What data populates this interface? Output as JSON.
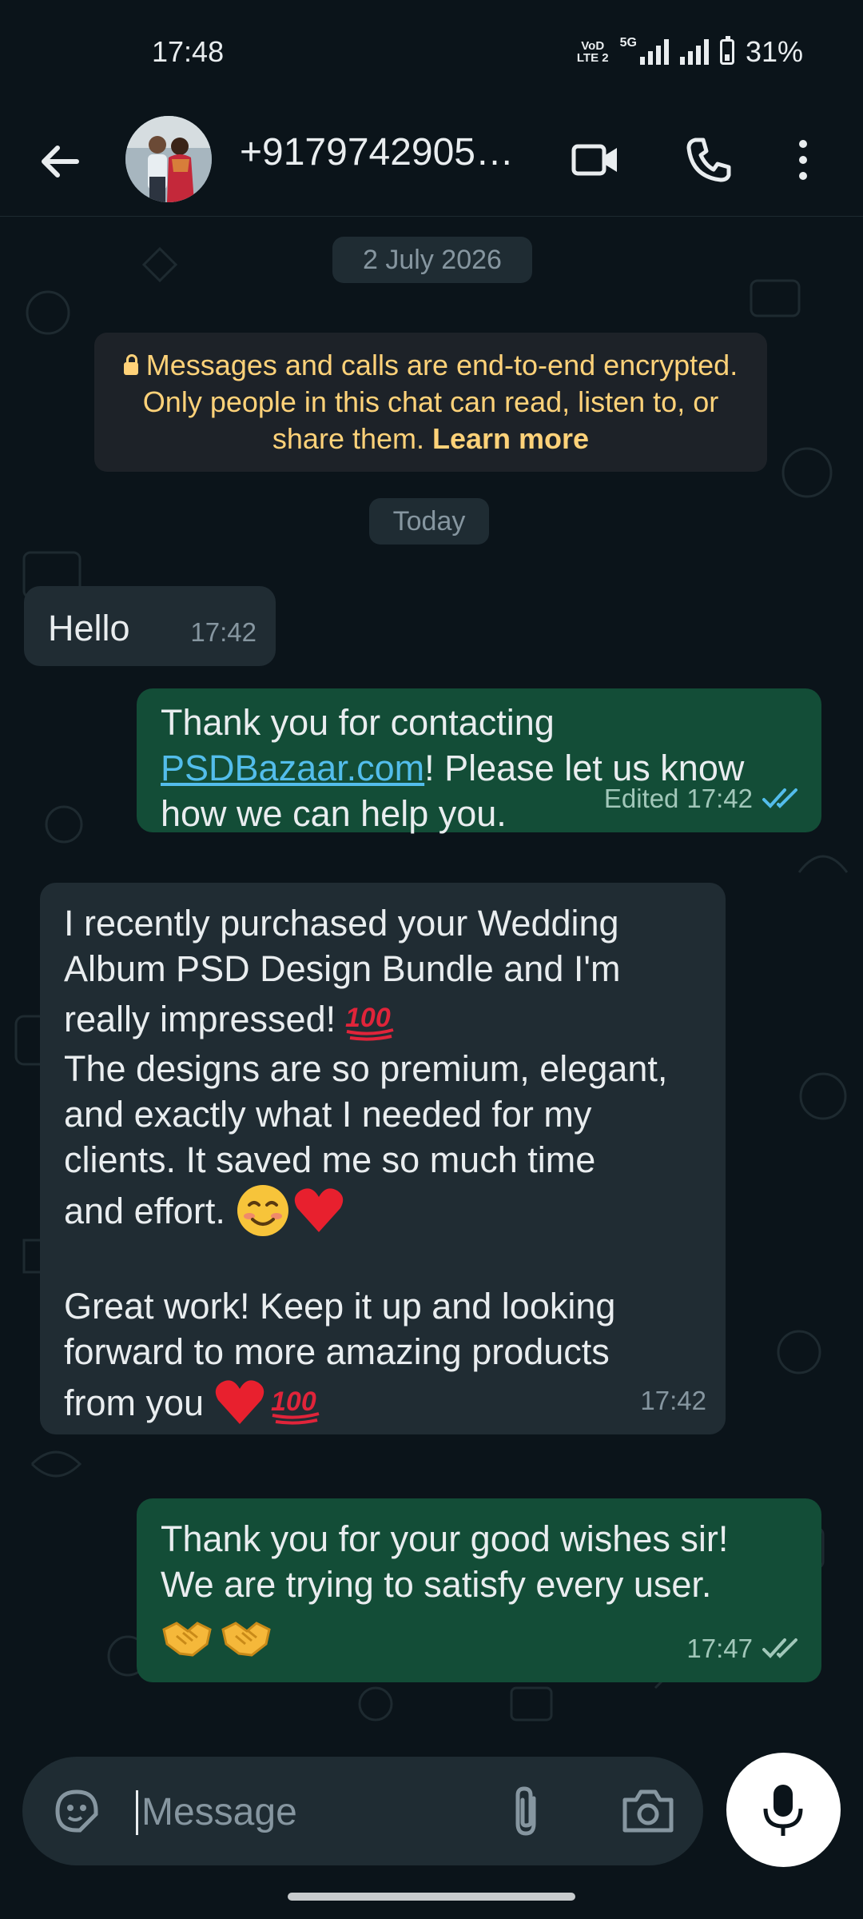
{
  "status_bar": {
    "time": "17:48",
    "volte_top": "VoD",
    "volte_bottom": "LTE 2",
    "network": "5G",
    "battery": "31%"
  },
  "header": {
    "contact": "+9179742905…"
  },
  "chat": {
    "date_pill": "2 July 2026",
    "encryption_text": "Messages and calls are end-to-end encrypted. Only people in this chat can read, listen to, or share them.",
    "encryption_link": "Learn more",
    "today_pill": "Today",
    "messages": [
      {
        "text": "Hello",
        "time": "17:42"
      },
      {
        "pre": "Thank you for contacting",
        "link": "PSDBazaar.com",
        "post": "! Please let us know how we can help you.",
        "edited": "Edited",
        "time": "17:42"
      },
      {
        "p1_l1": "I recently purchased your Wedding",
        "p1_l2": "Album PSD Design Bundle and I'm",
        "p1_l3": "really impressed!",
        "p2_l1": "The designs are so premium, elegant,",
        "p2_l2": "and exactly what I needed for my",
        "p2_l3": "clients. It saved me so much time",
        "p2_l4": "and effort.",
        "p3_l1": "Great work! Keep it up and looking",
        "p3_l2": "forward to more amazing products",
        "p3_l3": "from you",
        "time": "17:42"
      },
      {
        "l1": "Thank you for your good wishes sir!",
        "l2": "We are trying to satisfy every user.",
        "time": "17:47"
      }
    ]
  },
  "input": {
    "placeholder": "Message"
  }
}
